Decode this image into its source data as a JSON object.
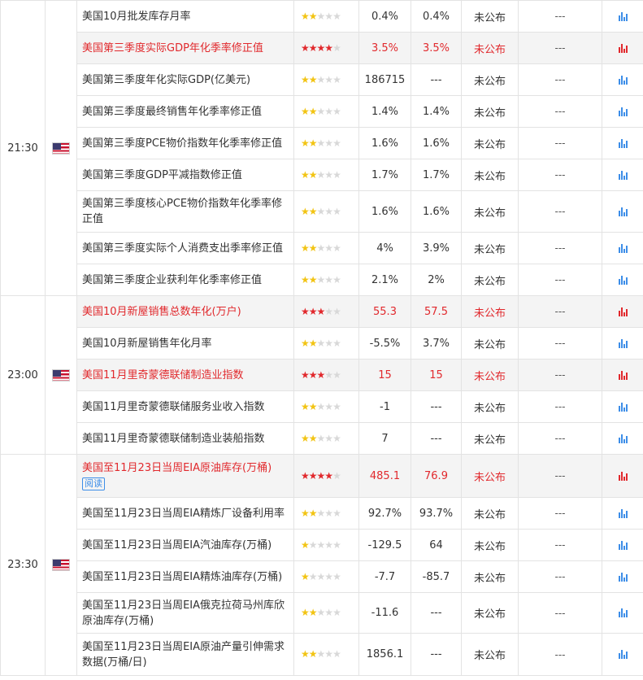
{
  "colors": {
    "important": "#e1292d",
    "star_on": "#f2c414",
    "star_off": "#d8d8d8",
    "icon": "#3d8ee8"
  },
  "groups": [
    {
      "time": "21:30",
      "flag": "us-flag-icon",
      "rows": [
        {
          "name": "美国10月批发库存月率",
          "stars": 2,
          "important": false,
          "prev": "0.4%",
          "forecast": "0.4%",
          "actual": "未公布",
          "dashes": "---"
        },
        {
          "name": "美国第三季度实际GDP年化季率修正值",
          "stars": 4,
          "important": true,
          "prev": "3.5%",
          "forecast": "3.5%",
          "actual": "未公布",
          "dashes": "---"
        },
        {
          "name": "美国第三季度年化实际GDP(亿美元)",
          "stars": 2,
          "important": false,
          "prev": "186715",
          "forecast": "---",
          "actual": "未公布",
          "dashes": "---"
        },
        {
          "name": "美国第三季度最终销售年化季率修正值",
          "stars": 2,
          "important": false,
          "prev": "1.4%",
          "forecast": "1.4%",
          "actual": "未公布",
          "dashes": "---"
        },
        {
          "name": "美国第三季度PCE物价指数年化季率修正值",
          "stars": 2,
          "important": false,
          "prev": "1.6%",
          "forecast": "1.6%",
          "actual": "未公布",
          "dashes": "---"
        },
        {
          "name": "美国第三季度GDP平减指数修正值",
          "stars": 2,
          "important": false,
          "prev": "1.7%",
          "forecast": "1.7%",
          "actual": "未公布",
          "dashes": "---"
        },
        {
          "name": "美国第三季度核心PCE物价指数年化季率修正值",
          "stars": 2,
          "important": false,
          "prev": "1.6%",
          "forecast": "1.6%",
          "actual": "未公布",
          "dashes": "---"
        },
        {
          "name": "美国第三季度实际个人消费支出季率修正值",
          "stars": 2,
          "important": false,
          "prev": "4%",
          "forecast": "3.9%",
          "actual": "未公布",
          "dashes": "---"
        },
        {
          "name": "美国第三季度企业获利年化季率修正值",
          "stars": 2,
          "important": false,
          "prev": "2.1%",
          "forecast": "2%",
          "actual": "未公布",
          "dashes": "---"
        }
      ]
    },
    {
      "time": "23:00",
      "flag": "us-flag-icon",
      "rows": [
        {
          "name": "美国10月新屋销售总数年化(万户)",
          "stars": 3,
          "important": true,
          "prev": "55.3",
          "forecast": "57.5",
          "actual": "未公布",
          "dashes": "---"
        },
        {
          "name": "美国10月新屋销售年化月率",
          "stars": 2,
          "important": false,
          "prev": "-5.5%",
          "forecast": "3.7%",
          "actual": "未公布",
          "dashes": "---"
        },
        {
          "name": "美国11月里奇蒙德联储制造业指数",
          "stars": 3,
          "important": true,
          "prev": "15",
          "forecast": "15",
          "actual": "未公布",
          "dashes": "---"
        },
        {
          "name": "美国11月里奇蒙德联储服务业收入指数",
          "stars": 2,
          "important": false,
          "prev": "-1",
          "forecast": "---",
          "actual": "未公布",
          "dashes": "---"
        },
        {
          "name": "美国11月里奇蒙德联储制造业装船指数",
          "stars": 2,
          "important": false,
          "prev": "7",
          "forecast": "---",
          "actual": "未公布",
          "dashes": "---"
        }
      ]
    },
    {
      "time": "23:30",
      "flag": "us-flag-icon",
      "rows": [
        {
          "name": "美国至11月23日当周EIA原油库存(万桶)",
          "tag": "阅读",
          "stars": 4,
          "important": true,
          "prev": "485.1",
          "forecast": "76.9",
          "actual": "未公布",
          "dashes": "---"
        },
        {
          "name": "美国至11月23日当周EIA精炼厂设备利用率",
          "stars": 2,
          "important": false,
          "prev": "92.7%",
          "forecast": "93.7%",
          "actual": "未公布",
          "dashes": "---"
        },
        {
          "name": "美国至11月23日当周EIA汽油库存(万桶)",
          "stars": 1,
          "important": false,
          "prev": "-129.5",
          "forecast": "64",
          "actual": "未公布",
          "dashes": "---"
        },
        {
          "name": "美国至11月23日当周EIA精炼油库存(万桶)",
          "stars": 1,
          "important": false,
          "prev": "-7.7",
          "forecast": "-85.7",
          "actual": "未公布",
          "dashes": "---"
        },
        {
          "name": "美国至11月23日当周EIA俄克拉荷马州库欣原油库存(万桶)",
          "stars": 2,
          "important": false,
          "prev": "-11.6",
          "forecast": "---",
          "actual": "未公布",
          "dashes": "---"
        },
        {
          "name": "美国至11月23日当周EIA原油产量引伸需求数据(万桶/日)",
          "stars": 2,
          "important": false,
          "prev": "1856.1",
          "forecast": "---",
          "actual": "未公布",
          "dashes": "---"
        }
      ]
    }
  ]
}
